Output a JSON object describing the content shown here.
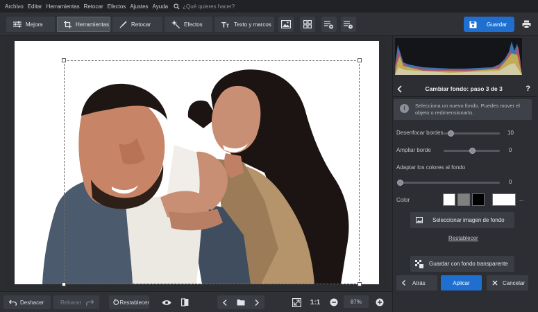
{
  "menu": [
    "Archivo",
    "Editar",
    "Herramientas",
    "Retocar",
    "Efectos",
    "Ajustes",
    "Ayuda"
  ],
  "search": {
    "placeholder": "¿Qué quieres hacer?"
  },
  "tabs": [
    {
      "label": "Mejora",
      "icon": "sliders-icon"
    },
    {
      "label": "Herramientas",
      "icon": "crop-icon",
      "active": true
    },
    {
      "label": "Retocar",
      "icon": "brush-icon"
    },
    {
      "label": "Efectos",
      "icon": "sparkle-icon"
    },
    {
      "label": "Texto y marcos",
      "icon": "text-icon"
    }
  ],
  "toolbar": {
    "save_label": "Guardar"
  },
  "bottom": {
    "undo_label": "Deshacer",
    "redo_label": "Rehacer",
    "reset_label": "Restablecer",
    "ratio_label": "1:1",
    "zoom": "87%"
  },
  "panel": {
    "title": "Cambiar fondo: paso 3 de 3",
    "help": "?",
    "info_line1": "Selecciona un nuevo fondo. Puedes mover el",
    "info_line2": "objeto o redimensionarlo.",
    "blur_label": "Desenfocar bordes",
    "blur_value": "10",
    "blur_level": 0.1,
    "expand_label": "Ampliar borde",
    "expand_value": "0",
    "expand_level": 0.5,
    "adapt_label": "Adaptar los colores al fondo",
    "adapt_value": "0",
    "adapt_level": 0.0,
    "color_label": "Color",
    "swatches": [
      "#ffffff",
      "#808080",
      "#000000"
    ],
    "custom_color": "#ffffff",
    "more": "...",
    "select_bg_label": "Seleccionar imagen de fondo",
    "reset_link": "Restablecer",
    "save_transparent_label": "Guardar con fondo transparente",
    "back_label": "Atrás",
    "apply_label": "Aplicar",
    "cancel_label": "Cancelar"
  },
  "colors": {
    "accent": "#1e6fd0",
    "panel": "#2c2e33",
    "toolbar": "#2f3136"
  }
}
